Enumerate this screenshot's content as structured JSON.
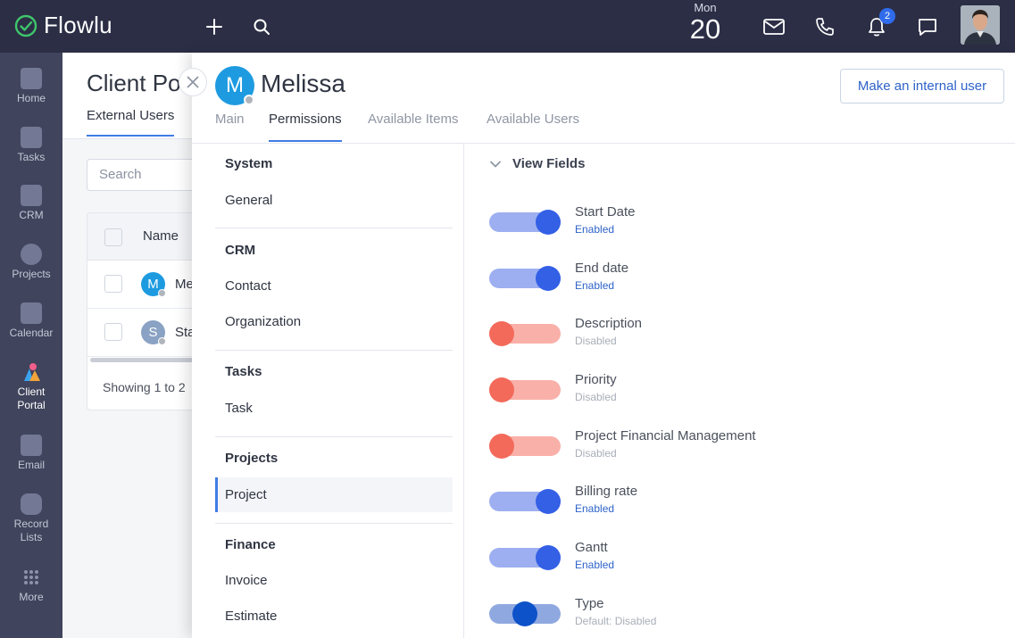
{
  "app": {
    "name": "Flowlu",
    "brand_color": "#2b2e45",
    "accent": "#3f7ce6"
  },
  "topbar": {
    "date_day": "Mon",
    "date_num": "20",
    "notification_count": "2"
  },
  "sidebar": {
    "items": [
      {
        "label": "Home",
        "icon": "home-icon"
      },
      {
        "label": "Tasks",
        "icon": "tasks-icon"
      },
      {
        "label": "CRM",
        "icon": "crm-icon"
      },
      {
        "label": "Projects",
        "icon": "projects-icon"
      },
      {
        "label": "Calendar",
        "icon": "calendar-icon"
      },
      {
        "label": "Client Portal",
        "icon": "client-portal-icon"
      },
      {
        "label": "Email",
        "icon": "email-icon"
      },
      {
        "label": "Record Lists",
        "icon": "record-lists-icon"
      },
      {
        "label": "More",
        "icon": "more-icon"
      }
    ]
  },
  "background_page": {
    "title": "Client Po",
    "tab": "External Users",
    "search_placeholder": "Search",
    "column_name": "Name",
    "rows": [
      {
        "initial": "M",
        "name": "Me",
        "color": "#1e9be0"
      },
      {
        "initial": "S",
        "name": "Sta",
        "color": "#8aa2c3"
      }
    ],
    "showing_text": "Showing 1 to 2"
  },
  "panel": {
    "avatar_initial": "M",
    "user_name": "Melissa",
    "make_internal_label": "Make an internal user",
    "tabs": [
      "Main",
      "Permissions",
      "Available Items",
      "Available Users"
    ],
    "active_tab": "Permissions",
    "sections": [
      {
        "heading": "System",
        "items": [
          "General"
        ]
      },
      {
        "heading": "CRM",
        "items": [
          "Contact",
          "Organization"
        ]
      },
      {
        "heading": "Tasks",
        "items": [
          "Task"
        ]
      },
      {
        "heading": "Projects",
        "items": [
          "Project"
        ]
      },
      {
        "heading": "Finance",
        "items": [
          "Invoice",
          "Estimate"
        ]
      }
    ],
    "active_section_item": "Project",
    "view_fields_title": "View Fields",
    "fields": [
      {
        "label": "Start Date",
        "status": "Enabled",
        "state": "on"
      },
      {
        "label": "End date",
        "status": "Enabled",
        "state": "on"
      },
      {
        "label": "Description",
        "status": "Disabled",
        "state": "off"
      },
      {
        "label": "Priority",
        "status": "Disabled",
        "state": "off"
      },
      {
        "label": "Project Financial Management",
        "status": "Disabled",
        "state": "off"
      },
      {
        "label": "Billing rate",
        "status": "Enabled",
        "state": "on"
      },
      {
        "label": "Gantt",
        "status": "Enabled",
        "state": "on"
      },
      {
        "label": "Type",
        "status": "Default: Disabled",
        "state": "default"
      }
    ]
  }
}
